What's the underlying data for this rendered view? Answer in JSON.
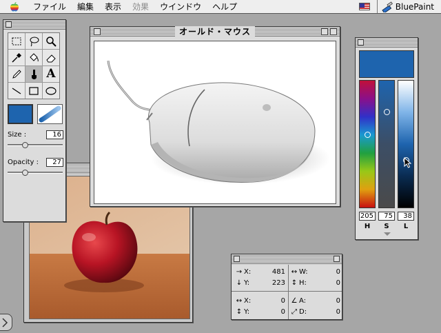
{
  "menubar": {
    "items": [
      {
        "label": "ファイル",
        "enabled": true
      },
      {
        "label": "編集",
        "enabled": true
      },
      {
        "label": "表示",
        "enabled": true
      },
      {
        "label": "効果",
        "enabled": false
      },
      {
        "label": "ウインドウ",
        "enabled": true
      },
      {
        "label": "ヘルプ",
        "enabled": true
      }
    ],
    "app_name": "BluePaint"
  },
  "tools_palette": {
    "tools": [
      "marquee-select-icon",
      "lasso-icon",
      "zoom-icon",
      "eyedropper-icon",
      "paint-bucket-icon",
      "eraser-icon",
      "pencil-icon",
      "brush-icon",
      "text-icon",
      "line-icon",
      "rectangle-icon",
      "ellipse-icon"
    ],
    "selected_tool": "brush-icon",
    "text_tool_glyph": "A",
    "current_color": "#1e64ae",
    "size_label": "Size :",
    "size_value": "16",
    "opacity_label": "Opacity :",
    "opacity_value": "27",
    "size_level": 0.3,
    "opacity_level": 0.3
  },
  "mouse_window": {
    "title": "オールド・マウス"
  },
  "color_picker": {
    "preview_color": "#1e64ae",
    "h_value": "205",
    "s_value": "75",
    "l_value": "38",
    "h_label": "H",
    "s_label": "S",
    "l_label": "L"
  },
  "info_panel": {
    "x_label": "X:",
    "x_value": "481",
    "y_label": "Y:",
    "y_value": "223",
    "w_label": "W:",
    "w_value": "0",
    "h_label": "H:",
    "h_value": "0",
    "dx_label": "X:",
    "dx_value": "0",
    "dy_label": "Y:",
    "dy_value": "0",
    "a_label": "A:",
    "a_value": "0",
    "d_label": "D:",
    "d_value": "0"
  }
}
